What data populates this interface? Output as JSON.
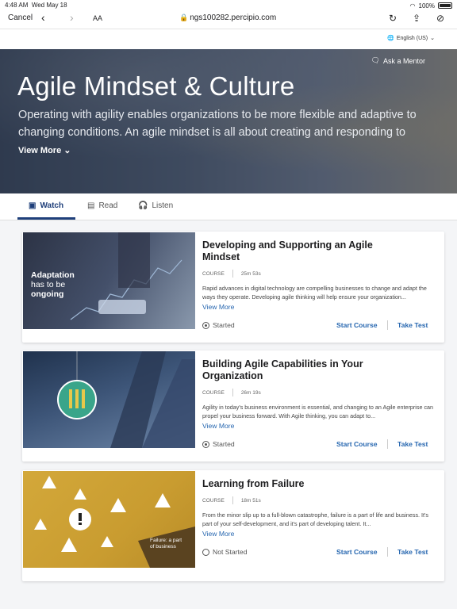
{
  "status_bar": {
    "time": "4:48 AM",
    "date": "Wed May 18",
    "battery": "100%"
  },
  "browser": {
    "cancel": "Cancel",
    "text_size": "AA",
    "url": "ngs100282.percipio.com"
  },
  "language": {
    "label": "English (US)"
  },
  "hero": {
    "ask_mentor": "Ask a Mentor",
    "title": "Agile Mindset & Culture",
    "description": "Operating with agility enables organizations to be more flexible and adaptive to changing conditions. An agile mindset is all about creating and responding to chan...",
    "view_more": "View More"
  },
  "tabs": [
    {
      "label": "Watch",
      "active": true
    },
    {
      "label": "Read",
      "active": false
    },
    {
      "label": "Listen",
      "active": false
    }
  ],
  "cards": [
    {
      "title": "Developing and Supporting an Agile Mindset",
      "type": "COURSE",
      "duration": "25m 53s",
      "description": "Rapid advances in digital technology are compelling businesses to change and adapt the ways they operate. Developing agile thinking will help ensure your organization...",
      "view_more": "View More",
      "status": "Started",
      "start": "Start Course",
      "test": "Take Test",
      "thumb_text_1": "Adaptation",
      "thumb_text_2": "has to be",
      "thumb_text_3": "ongoing"
    },
    {
      "title": "Building Agile Capabilities in Your Organization",
      "type": "COURSE",
      "duration": "26m 19s",
      "description": "Agility in today's business environment is essential, and changing to an Agile enterprise can propel your business forward. With Agile thinking, you can adapt to...",
      "view_more": "View More",
      "status": "Started",
      "start": "Start Course",
      "test": "Take Test"
    },
    {
      "title": "Learning from Failure",
      "type": "COURSE",
      "duration": "18m 51s",
      "description": "From the minor slip up to a full-blown catastrophe, failure is a part of life and business. It's part of your self-development, and it's part of developing talent. It...",
      "view_more": "View More",
      "status": "Not Started",
      "start": "Start Course",
      "test": "Take Test",
      "thumb_text_1": "Failure: a part",
      "thumb_text_2": "of business"
    }
  ]
}
